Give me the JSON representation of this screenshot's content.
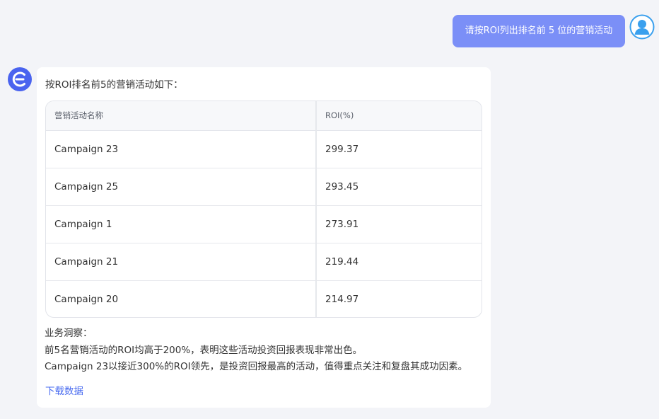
{
  "user_message": "请按ROI列出排名前 5 位的营销活动",
  "bot": {
    "intro": "按ROI排名前5的营销活动如下：",
    "table": {
      "headers": [
        "营销活动名称",
        "ROI(%)"
      ],
      "rows": [
        [
          "Campaign 23",
          "299.37"
        ],
        [
          "Campaign 25",
          "293.45"
        ],
        [
          "Campaign 1",
          "273.91"
        ],
        [
          "Campaign 21",
          "219.44"
        ],
        [
          "Campaign 20",
          "214.97"
        ]
      ]
    },
    "insight_title": "业务洞察：",
    "insight_lines": [
      "前5名营销活动的ROI均高于200%，表明这些活动投资回报表现非常出色。",
      "Campaign 23以接近300%的ROI领先，是投资回报最高的活动，值得重点关注和复盘其成功因素。"
    ],
    "download_label": "下载数据"
  },
  "icons": {
    "user_avatar": "user-avatar-icon",
    "bot_avatar": "assistant-logo-icon"
  },
  "colors": {
    "user_bubble": "#7b8ff7",
    "bot_logo": "#4a63ef",
    "link": "#4a6cf0",
    "avatar": "#3aa0ee"
  }
}
